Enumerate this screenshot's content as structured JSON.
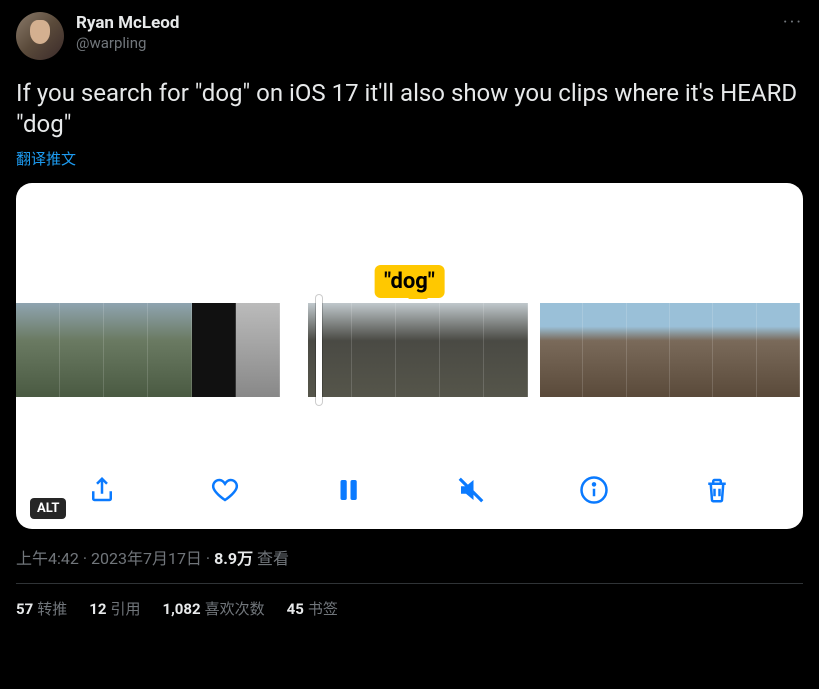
{
  "author": {
    "display_name": "Ryan McLeod",
    "handle": "@warpling"
  },
  "more_label": "···",
  "body": "If you search for \"dog\" on iOS 17 it'll also show you clips where it's HEARD \"dog\"",
  "translate_label": "翻译推文",
  "media": {
    "search_token": "\"dog\"",
    "alt_badge": "ALT",
    "toolbar": {
      "share": "share",
      "like": "like",
      "pause": "pause",
      "mute": "mute",
      "info": "info",
      "trash": "trash"
    }
  },
  "meta": {
    "time": "上午4:42",
    "sep1": " · ",
    "date": "2023年7月17日",
    "sep2": " · ",
    "views_count": "8.9万",
    "views_label": " 查看"
  },
  "stats": {
    "retweets": {
      "count": "57",
      "label": "转推"
    },
    "quotes": {
      "count": "12",
      "label": "引用"
    },
    "likes": {
      "count": "1,082",
      "label": "喜欢次数"
    },
    "bookmarks": {
      "count": "45",
      "label": "书签"
    }
  }
}
